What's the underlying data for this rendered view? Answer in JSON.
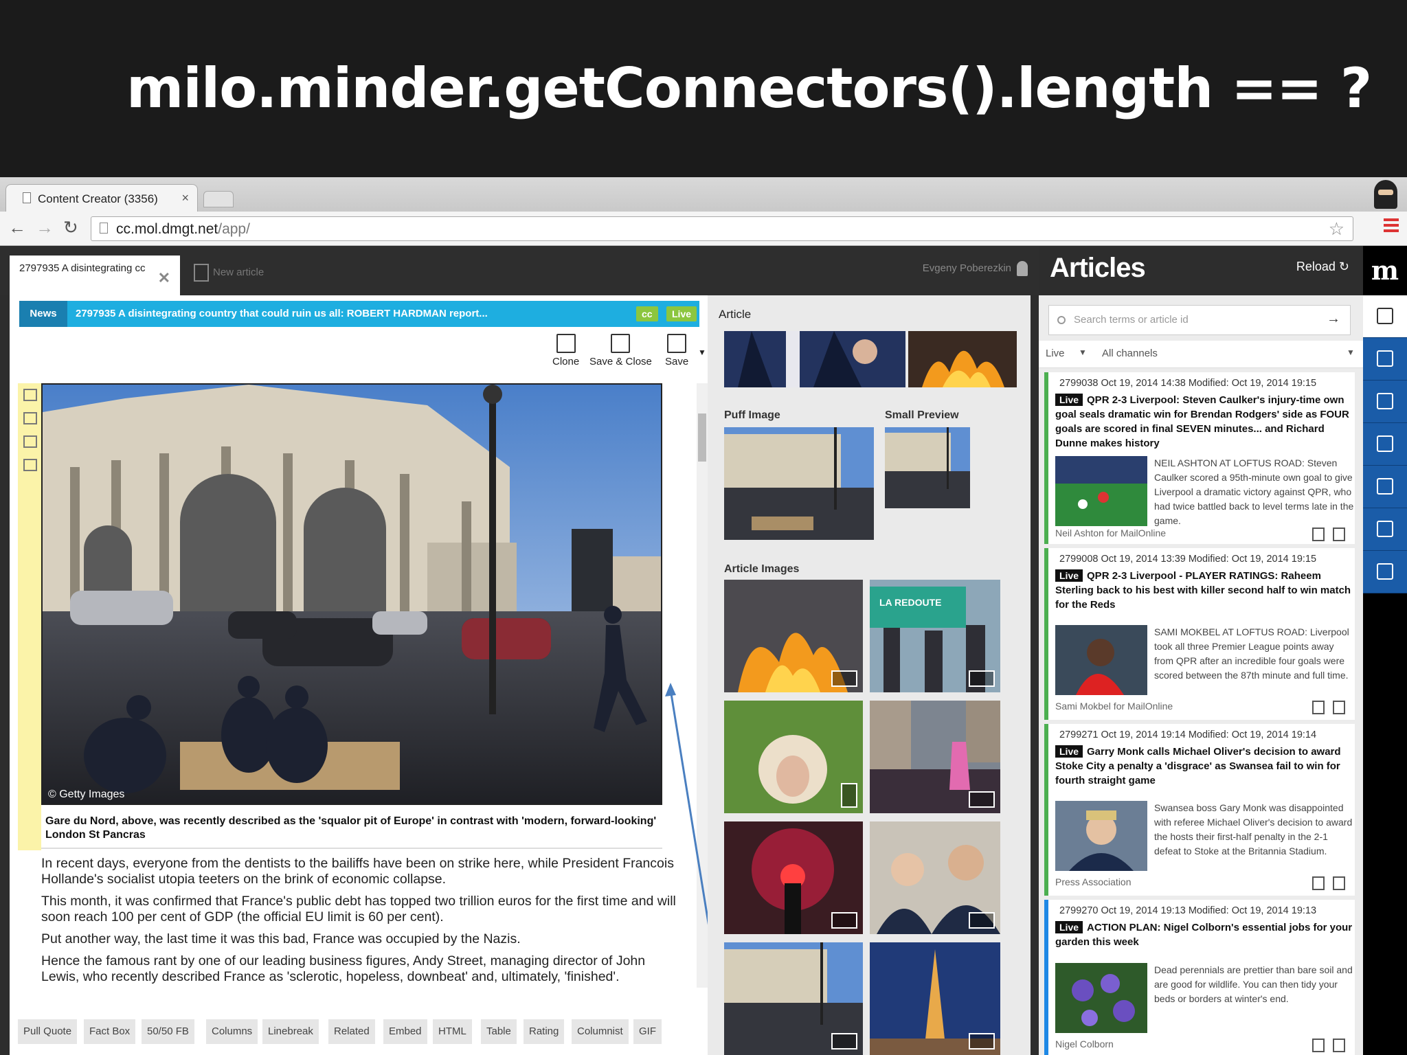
{
  "slide": {
    "title": "milo.minder.getConnectors().length == ?"
  },
  "browser": {
    "tab_title": "Content Creator (3356)",
    "tab_close": "×",
    "url_host": "cc.mol.dmgt.net",
    "url_path": "/app/"
  },
  "editor": {
    "tab_label": "2797935 A disintegrating cc",
    "new_article": "New article",
    "user": "Evgeny Poberezkin",
    "section": "News",
    "headline": "2797935 A disintegrating country that could ruin us all: ROBERT HARDMAN report...",
    "badge_cc": "cc",
    "badge_live": "Live",
    "actions": {
      "clone": "Clone",
      "save_close": "Save & Close",
      "save": "Save"
    },
    "photo_credit": "© Getty Images",
    "caption": "Gare du Nord, above, was recently described as the 'squalor pit of Europe' in contrast with 'modern, forward-looking' London St Pancras",
    "paragraphs": [
      "In recent days, everyone from the dentists to the bailiffs have been on strike here, while President Francois Hollande's socialist utopia teeters on the brink of economic collapse.",
      "This month, it was confirmed that France's public debt has topped two trillion euros for the first time and will soon reach 100 per cent of GDP (the official EU limit is 60 per cent).",
      "Put another way, the last time it was this bad, France was occupied by the Nazis.",
      "Hence the famous rant by one of our leading business figures, Andy Street, managing director of John Lewis, who recently described France as 'sclerotic, hopeless, downbeat' and, ultimately, 'finished'."
    ],
    "bottom_buttons": [
      "Pull Quote",
      "Fact Box",
      "50/50 FB",
      "Columns",
      "Linebreak",
      "Related",
      "Embed",
      "HTML",
      "Table",
      "Rating",
      "Columnist",
      "GIF"
    ]
  },
  "image_panel": {
    "heading": "Article",
    "puff_label": "Puff Image",
    "small_label": "Small Preview",
    "article_images_label": "Article Images",
    "shop_sign": "LA REDOUTE"
  },
  "articles": {
    "title": "Articles",
    "reload": "Reload",
    "search_placeholder": "Search terms or article id",
    "filter_status": "Live",
    "filter_channel": "All channels",
    "items": [
      {
        "meta": "2799038  Oct 19, 2014 14:38   Modified: Oct 19, 2014 19:15",
        "live": "Live",
        "headline": "QPR 2-3 Liverpool: Steven Caulker's injury-time own goal seals dramatic win for Brendan Rodgers' side as FOUR goals are scored in final SEVEN minutes... and Richard Dunne makes history",
        "summary": "NEIL ASHTON AT LOFTUS ROAD: Steven Caulker scored a 95th-minute own goal to give Liverpool a dramatic victory against QPR, who had twice battled back to level terms late in the game.",
        "byline": "Neil Ashton for MailOnline"
      },
      {
        "meta": "2799008  Oct 19, 2014 13:39   Modified: Oct 19, 2014 19:15",
        "live": "Live",
        "headline": "QPR 2-3 Liverpool - PLAYER RATINGS: Raheem Sterling back to his best with killer second half to win match for the Reds",
        "summary": "SAMI MOKBEL AT LOFTUS ROAD: Liverpool took all three Premier League points away from QPR after an incredible four goals were scored between the 87th minute and full time.",
        "byline": "Sami Mokbel for MailOnline"
      },
      {
        "meta": "2799271  Oct 19, 2014 19:14   Modified: Oct 19, 2014 19:14",
        "live": "Live",
        "headline": "Garry Monk calls Michael Oliver's decision to award Stoke City a penalty a 'disgrace' as Swansea fail to win for fourth straight game",
        "summary": "Swansea boss Gary Monk was disappointed with referee Michael Oliver's decision to award the hosts their first-half penalty in the 2-1 defeat to Stoke at the Britannia Stadium.",
        "byline": "Press Association"
      },
      {
        "meta": "2799270  Oct 19, 2014 19:13   Modified: Oct 19, 2014 19:13",
        "live": "Live",
        "headline": "ACTION PLAN: Nigel Colborn's essential jobs for your garden this week",
        "summary": "Dead perennials are prettier than bare soil and are good for wildlife. You can then tidy your beds or borders at winter's end.",
        "byline": "Nigel Colborn"
      }
    ]
  },
  "rail": {
    "logo": "m"
  },
  "colors": {
    "news_bar": "#1eaee0",
    "live_badge": "#8cc63f",
    "rail_blue": "#1a5ca8",
    "item_green": "#4caf50",
    "item_blue": "#1e88e5"
  }
}
